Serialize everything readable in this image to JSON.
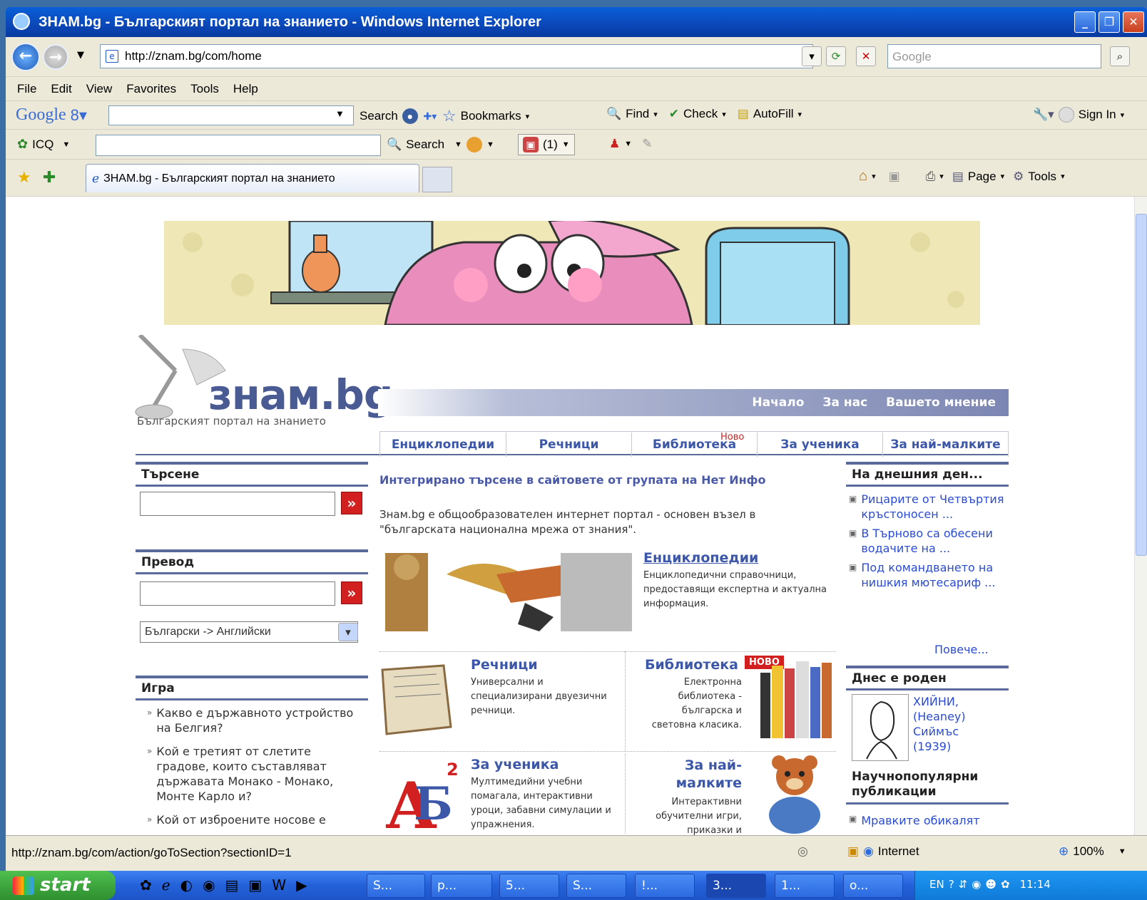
{
  "window": {
    "title": "ЗНАМ.bg - Българският портал на знанието - Windows Internet Explorer"
  },
  "address": {
    "url": "http://znam.bg/com/home",
    "search_placeholder": "Google"
  },
  "menu": [
    "File",
    "Edit",
    "View",
    "Favorites",
    "Tools",
    "Help"
  ],
  "google_bar": {
    "logo": "Google",
    "search": "Search",
    "bookmarks": "Bookmarks",
    "find": "Find",
    "check": "Check",
    "autofill": "AutoFill",
    "sign_in": "Sign In"
  },
  "icq_bar": {
    "label": "ICQ",
    "search": "Search",
    "count": "(1)"
  },
  "tab": {
    "title": "ЗНАМ.bg - Българският портал на знанието"
  },
  "commandbar": {
    "page": "Page",
    "tools": "Tools"
  },
  "site": {
    "logo": "знам.bg",
    "tagline": "Българският портал на знанието",
    "topnav": [
      "Начало",
      "За нас",
      "Вашето мнение"
    ],
    "sections": [
      "Енциклопедии",
      "Речници",
      "Библиотека",
      "За ученика",
      "За най-малките"
    ],
    "new_badge": "Ново",
    "search": {
      "title": "Търсене",
      "go": "»"
    },
    "translate": {
      "title": "Превод",
      "go": "»",
      "language": "Български -> Английски"
    },
    "game": {
      "title": "Игра",
      "questions": [
        "Какво е държавното устройство на Белгия?",
        "Кой е третият от слетите градове, които съставляват държавата Монако - Монако, Монте Карло и?",
        "Кой от изброените носове е"
      ]
    },
    "integrated": "Интегрирано търсене в сайтовете от групата на Нет Инфо",
    "intro": "Знам.bg е общообразователен интернет портал - основен възел в \"българската национална мрежа от знания\".",
    "enc": {
      "title": "Енциклопедии",
      "desc": "Енциклопедични справочници, предоставящи експертна и актуална информация."
    },
    "dict": {
      "title": "Речници",
      "desc": "Универсални и специализирани двуезични речници."
    },
    "lib": {
      "title": "Библиотека",
      "badge": "НОВО",
      "desc": "Електронна библиотека - българска и световна класика."
    },
    "student": {
      "title": "За ученика",
      "desc": "Мултимедийни учебни помагала, интерактивни уроци, забавни симулации и упражнения."
    },
    "kids": {
      "title": "За най-малките",
      "desc": "Интерактивни обучителни игри, приказки и"
    },
    "today": {
      "title": "На днешния ден...",
      "items": [
        "Рицарите от Четвъртия кръстоносен ...",
        "В Търново са обесени водачите на ...",
        "Под командването на нишкия мютесариф ..."
      ],
      "more": "Повече..."
    },
    "born": {
      "title": "Днес е роден",
      "text": "ХИЙНИ, (Heaney) Сиймъс (1939)"
    },
    "pubs": {
      "title": "Научнопопулярни публикации",
      "item": "Мравките обикалят"
    }
  },
  "status": {
    "url": "http://znam.bg/com/action/goToSection?sectionID=1",
    "zone": "Internet",
    "zoom": "100%"
  },
  "taskbar": {
    "start": "start",
    "items": [
      "S...",
      "p...",
      "5...",
      "S...",
      "!...",
      "3...",
      "1...",
      "o..."
    ],
    "lang": "EN",
    "time": "11:14"
  }
}
